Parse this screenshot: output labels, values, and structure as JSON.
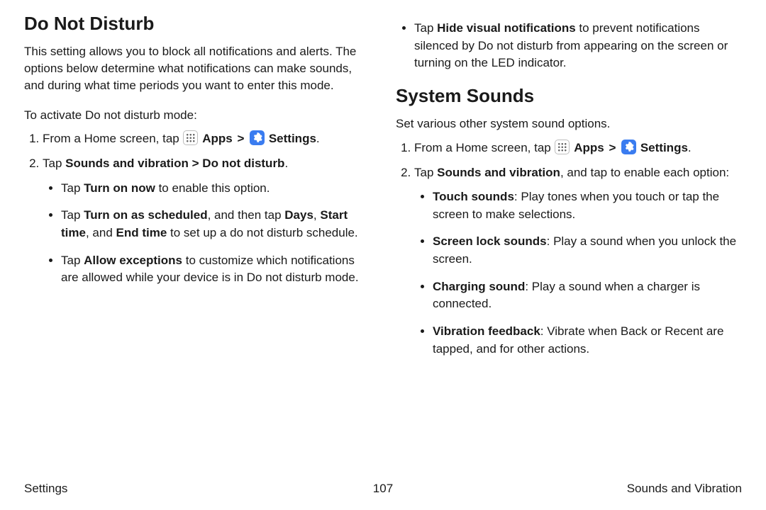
{
  "left": {
    "title": "Do Not Disturb",
    "intro": "This setting allows you to block all notifications and alerts. The options below determine what notifications can make sounds, and during what time periods you want to enter this mode.",
    "lead": "To activate Do not disturb mode:",
    "step1_a": "From a Home screen, tap ",
    "apps_label": "Apps",
    "settings_label": "Settings",
    "period": ".",
    "step2_a": "Tap ",
    "step2_b": "Sounds and vibration > Do not disturb",
    "sub1_a": "Tap ",
    "sub1_b": "Turn on now",
    "sub1_c": " to enable this option.",
    "sub2_a": "Tap ",
    "sub2_b": "Turn on as scheduled",
    "sub2_c": ", and then tap ",
    "sub2_d": "Days",
    "sub2_e": ", ",
    "sub2_f": "Start time",
    "sub2_g": ", and ",
    "sub2_h": "End time",
    "sub2_i": " to set up a do not disturb schedule.",
    "sub3_a": "Tap ",
    "sub3_b": "Allow exceptions",
    "sub3_c": " to customize which notifications are allowed while your device is in Do not disturb mode."
  },
  "right": {
    "sub4_a": "Tap ",
    "sub4_b": "Hide visual notifications",
    "sub4_c": " to prevent notifications silenced by Do not disturb from appearing on the screen or turning on the LED indicator.",
    "sys_title": "System Sounds",
    "sys_intro": "Set various other system sound options.",
    "step1_a": "From a Home screen, tap ",
    "apps_label": "Apps",
    "settings_label": "Settings",
    "period": ".",
    "step2_a": "Tap ",
    "step2_b": "Sounds and vibration",
    "step2_c": ", and tap to enable each option:",
    "sub1_b": "Touch sounds",
    "sub1_c": ": Play tones when you touch or tap the screen to make selections.",
    "sub2_b": "Screen lock sounds",
    "sub2_c": ": Play a sound when you unlock the screen.",
    "sub3_b": "Charging sound",
    "sub3_c": ": Play a sound when a charger is connected.",
    "sub4b_b": "Vibration feedback",
    "sub4b_c": ": Vibrate when Back or Recent are tapped, and for other actions."
  },
  "footer": {
    "left": "Settings",
    "center": "107",
    "right": "Sounds and Vibration"
  },
  "glyph": {
    "chev": ">"
  }
}
